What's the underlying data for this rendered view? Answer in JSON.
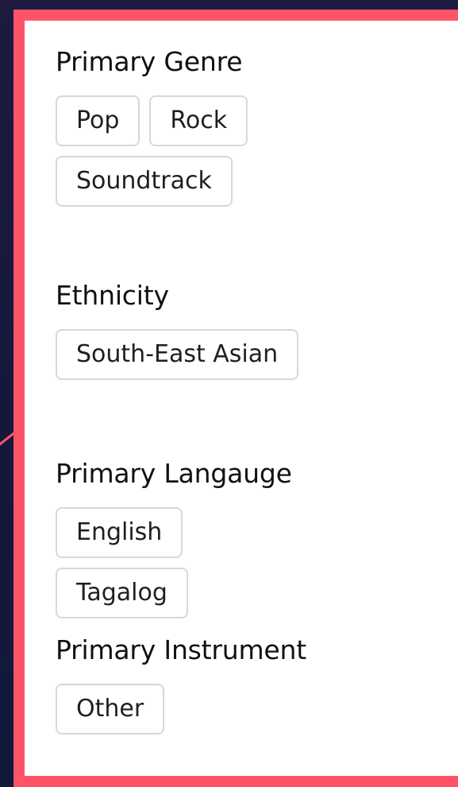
{
  "sections": [
    {
      "title": "Primary Genre",
      "chips": [
        "Pop",
        "Rock",
        "Soundtrack"
      ]
    },
    {
      "title": "Ethnicity",
      "chips": [
        "South-East Asian"
      ]
    },
    {
      "title": "Primary Langauge",
      "chips": [
        "English",
        "Tagalog"
      ]
    },
    {
      "title": "Primary Instrument",
      "chips": [
        "Other"
      ]
    }
  ],
  "colors": {
    "background": "#181a3e",
    "panel_border": "#ff5468",
    "chip_border": "#d8d8d8",
    "text": "#111111"
  }
}
